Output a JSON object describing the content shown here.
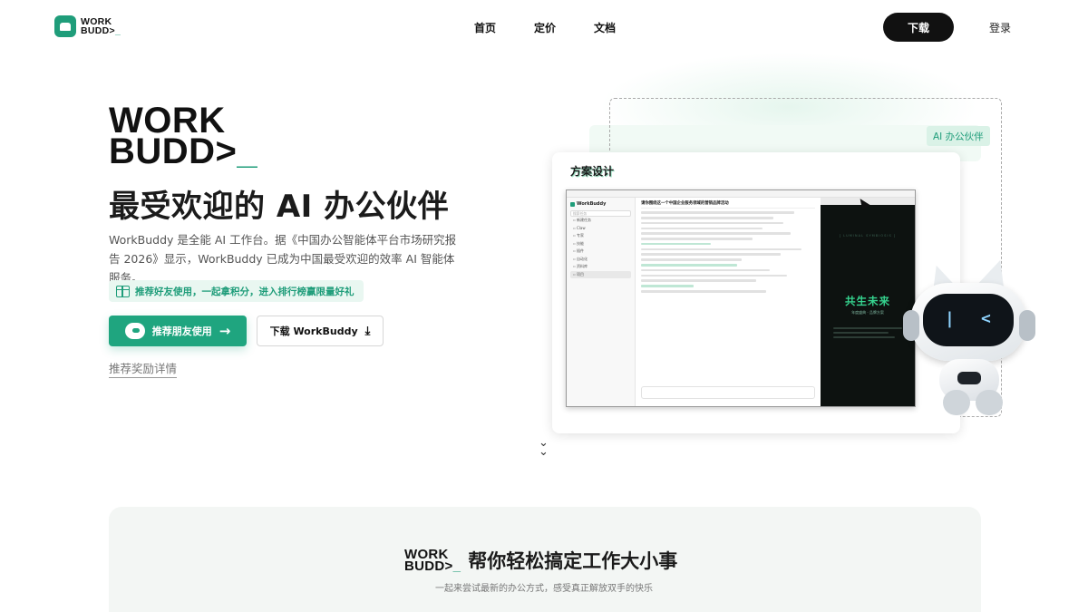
{
  "brand": {
    "line1": "WORK",
    "line2": "BUDD>",
    "dash": "_",
    "accent": "#1f9d7a"
  },
  "nav": {
    "items": [
      "首页",
      "定价",
      "文档"
    ],
    "download_label": "下载",
    "login_label": "登录"
  },
  "hero": {
    "title": "最受欢迎的 AI 办公伙伴",
    "description": "WorkBuddy 是全能 AI 工作台。据《中国办公智能体平台市场研究报告 2026》显示，WorkBuddy 已成为中国最受欢迎的效率 AI 智能体服务。",
    "promo": "推荐好友使用，一起拿积分，进入排行榜赢限量好礼",
    "primary_button": "推荐朋友使用",
    "secondary_button": "下载 WorkBuddy",
    "reward_link": "推荐奖励详情"
  },
  "visual": {
    "badge": "AI 办公伙伴",
    "card_title": "方案设计",
    "app_name": "WorkBuddy",
    "search_placeholder": "搜索任务",
    "sidebar_items": [
      "新建任务",
      "Claw",
      "专家",
      "技能",
      "插件",
      "自动化",
      "资料库",
      "项目"
    ],
    "task_title": "请你围绕这一个中国企业服务领域的营销品牌活动",
    "preview_head": "[ LUMINAL SYMBIOSIS ]",
    "preview_title": "共生未来",
    "preview_sub": "年度盛典 · 品牌方案"
  },
  "section": {
    "title": "帮你轻松搞定工作大小事",
    "subtitle": "一起来尝试最新的办公方式，感受真正解放双手的快乐"
  }
}
